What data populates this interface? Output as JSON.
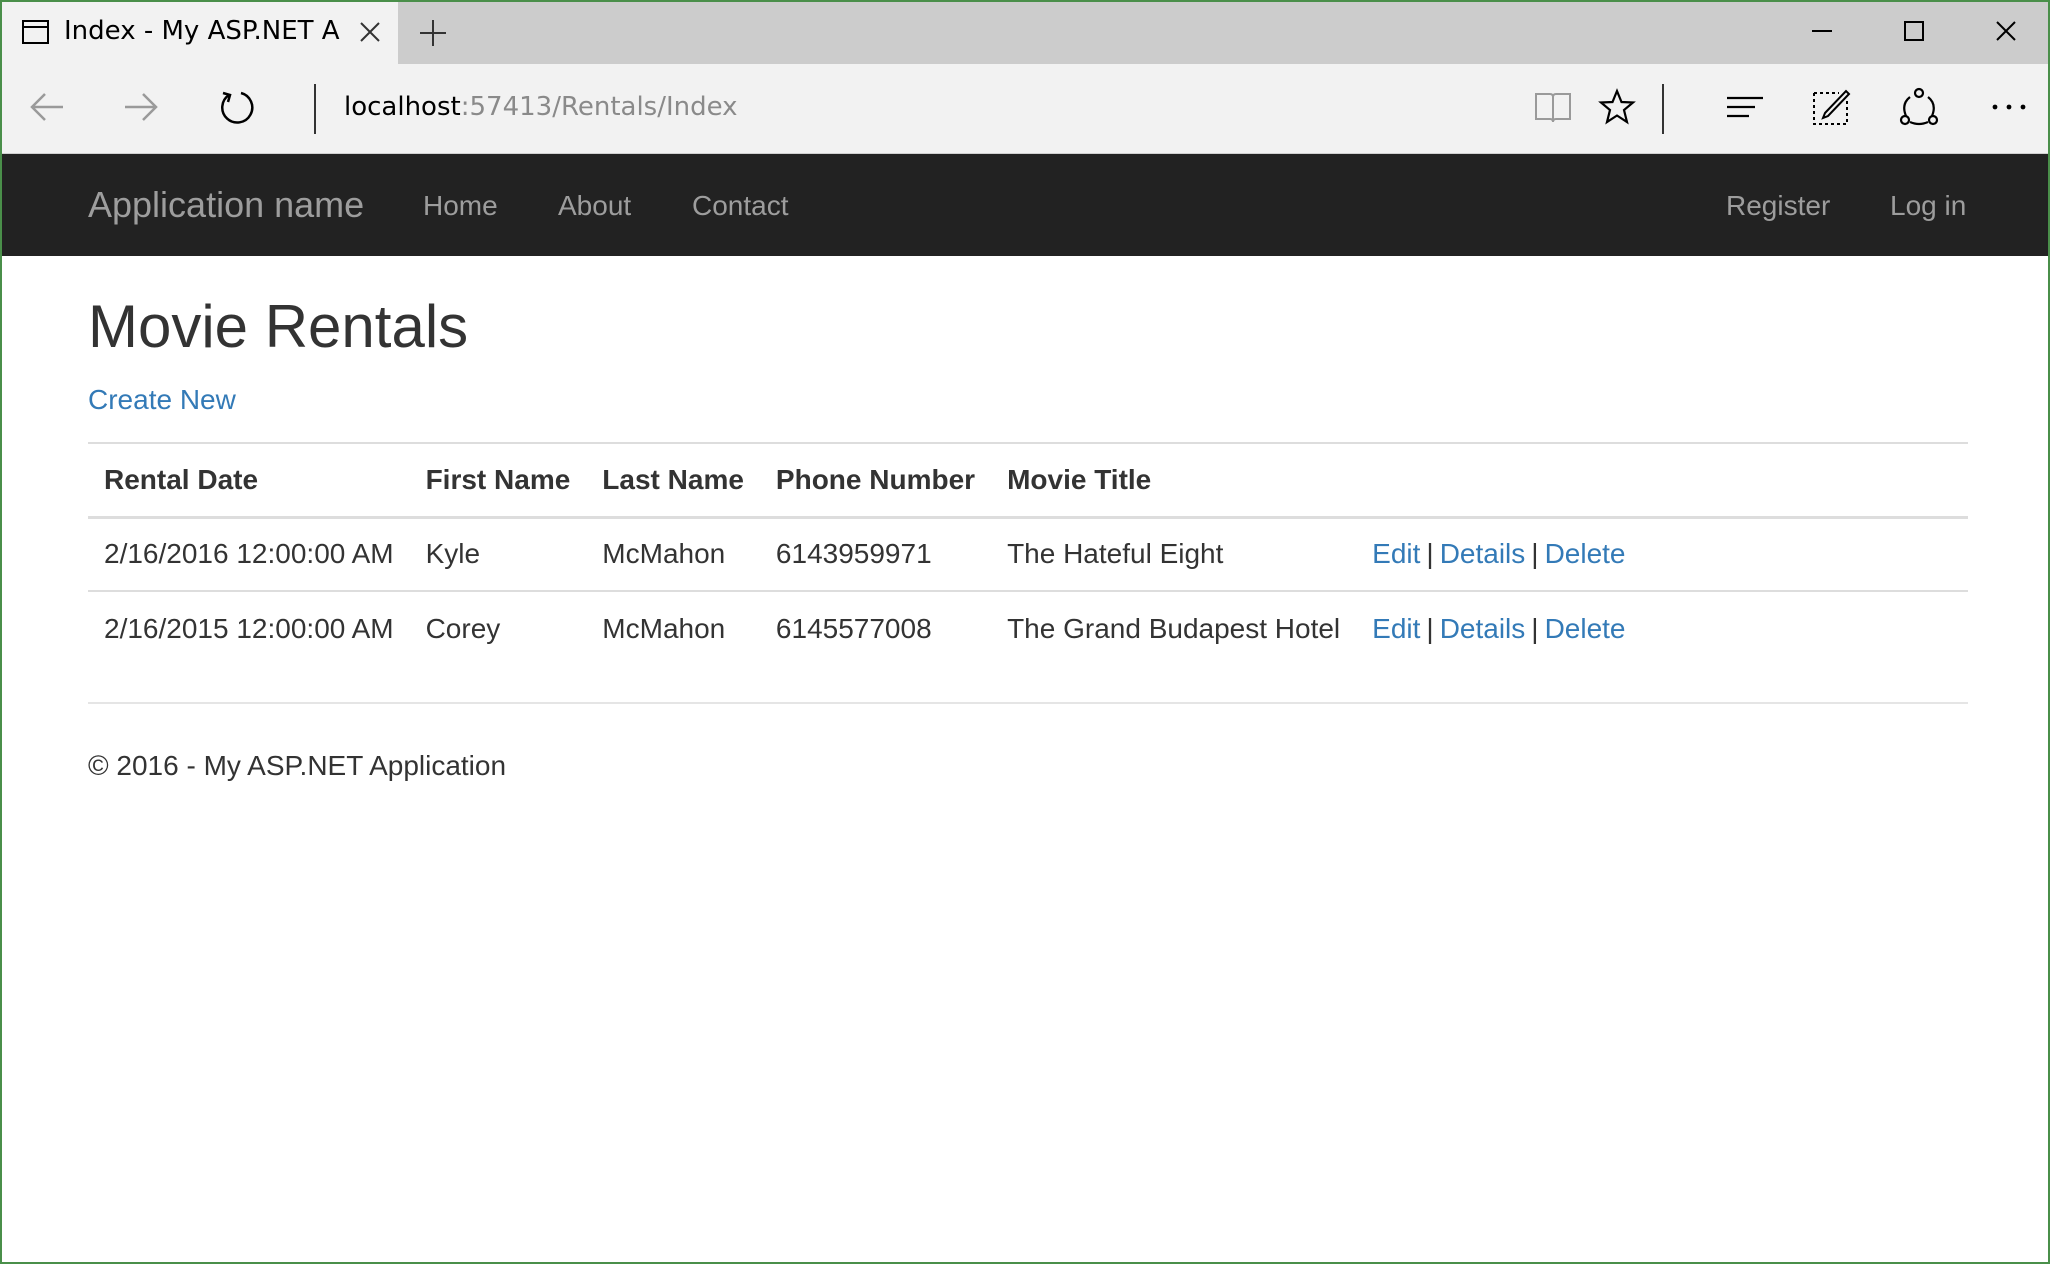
{
  "browser": {
    "tab_title": "Index - My ASP.NET App",
    "address_host": "localhost",
    "address_path": ":57413/Rentals/Index"
  },
  "site": {
    "brand": "Application name",
    "nav": {
      "home": "Home",
      "about": "About",
      "contact": "Contact",
      "register": "Register",
      "login": "Log in"
    }
  },
  "page": {
    "title": "Movie Rentals",
    "create_new": "Create New"
  },
  "table": {
    "headers": {
      "rental_date": "Rental Date",
      "first_name": "First Name",
      "last_name": "Last Name",
      "phone": "Phone Number",
      "movie_title": "Movie Title"
    },
    "rows": [
      {
        "rental_date": "2/16/2016 12:00:00 AM",
        "first_name": "Kyle",
        "last_name": "McMahon",
        "phone": "6143959971",
        "movie_title": "The Hateful Eight",
        "edit": "Edit",
        "separator_1": "|",
        "details": "Details",
        "separator_2": "|",
        "delete": "Delete"
      },
      {
        "rental_date": "2/16/2015 12:00:00 AM",
        "first_name": "Corey",
        "last_name": "McMahon",
        "phone": "6145577008",
        "movie_title": "The Grand Budapest Hotel",
        "edit": "Edit",
        "separator_1": "|",
        "details": "Details",
        "separator_2": "|",
        "delete": "Delete"
      }
    ]
  },
  "footer": {
    "text": "© 2016 - My ASP.NET Application"
  },
  "icons": {
    "tab": "page-icon",
    "tab_close": "close-icon",
    "new_tab": "plus-icon",
    "minimize": "minimize-icon",
    "maximize": "maximize-icon",
    "close": "close-icon",
    "back": "arrow-left-icon",
    "forward": "arrow-right-icon",
    "refresh": "refresh-icon",
    "reading_view": "book-icon",
    "favorite": "star-icon",
    "hub": "hub-icon",
    "web_note": "pen-note-icon",
    "share": "share-icon",
    "more": "more-icon"
  },
  "colors": {
    "navbar_bg": "#222222",
    "nav_text": "#9d9d9d",
    "link": "#337ab7",
    "body_text": "#333333"
  }
}
